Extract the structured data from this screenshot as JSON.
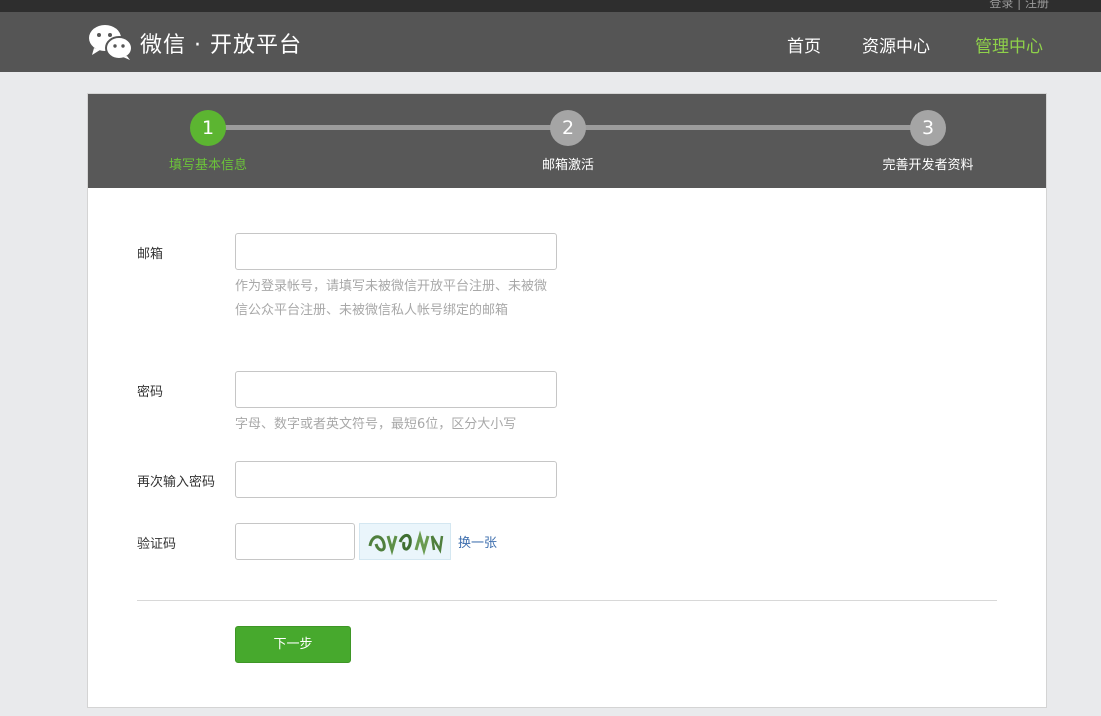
{
  "header": {
    "logo_text": "微信 · 开放平台",
    "top_strip_text": "登录 | 注册",
    "nav": [
      {
        "label": "首页",
        "active": false
      },
      {
        "label": "资源中心",
        "active": false
      },
      {
        "label": "管理中心",
        "active": true
      }
    ]
  },
  "steps": [
    {
      "number": "1",
      "label": "填写基本信息",
      "status": "done"
    },
    {
      "number": "2",
      "label": "邮箱激活",
      "status": "pending"
    },
    {
      "number": "3",
      "label": "完善开发者资料",
      "status": "pending"
    }
  ],
  "form": {
    "email": {
      "label": "邮箱",
      "value": "",
      "hint": "作为登录帐号，请填写未被微信开放平台注册、未被微信公众平台注册、未被微信私人帐号绑定的邮箱"
    },
    "password": {
      "label": "密码",
      "value": "",
      "hint": "字母、数字或者英文符号，最短6位，区分大小写"
    },
    "confirm_password": {
      "label": "再次输入密码",
      "value": ""
    },
    "captcha": {
      "label": "验证码",
      "value": "",
      "refresh_label": "换一张"
    },
    "next_button": "下一步"
  },
  "colors": {
    "accent_green": "#5cb531",
    "nav_active": "#8fd14a",
    "header_bg": "#555555",
    "link_blue": "#3f6fae"
  }
}
